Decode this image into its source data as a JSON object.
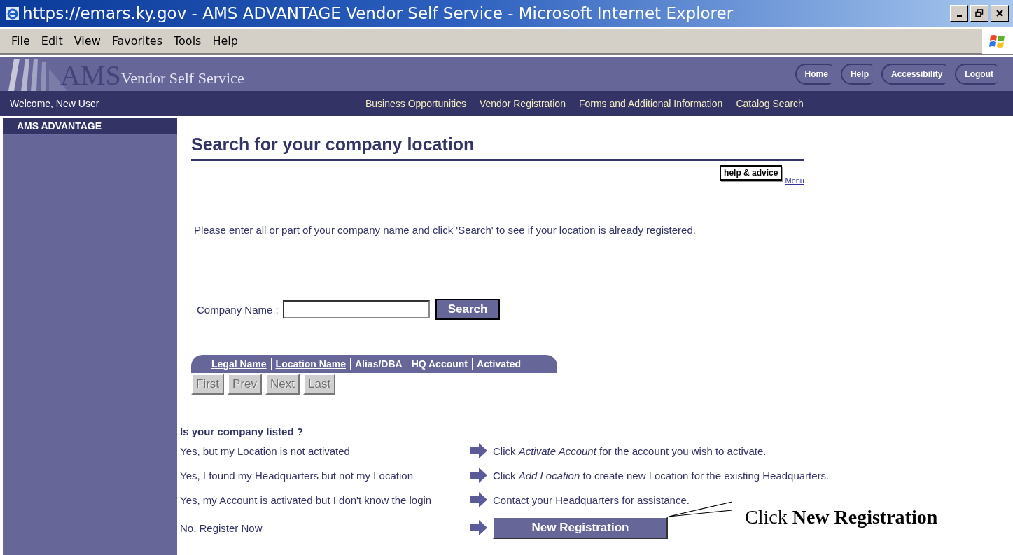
{
  "window": {
    "title": "https://emars.ky.gov - AMS ADVANTAGE Vendor Self Service - Microsoft Internet Explorer"
  },
  "menu_bar": [
    "File",
    "Edit",
    "View",
    "Favorites",
    "Tools",
    "Help"
  ],
  "banner": {
    "logo_mark": "AMS",
    "logo_text": "Vendor Self Service",
    "links": [
      "Home",
      "Help",
      "Accessibility",
      "Logout"
    ]
  },
  "nav_bar": {
    "welcome": "Welcome, New User",
    "links": [
      "Business Opportunities",
      "Vendor Registration",
      "Forms and Additional Information",
      "Catalog Search"
    ]
  },
  "sidebar": {
    "title": "AMS ADVANTAGE"
  },
  "page": {
    "heading": "Search for your company location",
    "help_button": "help & advice",
    "menu_link": "Menu",
    "instructions": "Please enter all or part of your company name and click 'Search' to see if your location is already registered.",
    "search": {
      "label": "Company Name :",
      "button": "Search"
    },
    "table": {
      "columns": [
        {
          "label": "Legal Name",
          "sortable": true
        },
        {
          "label": "Location Name",
          "sortable": true
        },
        {
          "label": "Alias/DBA",
          "sortable": false
        },
        {
          "label": "HQ Account",
          "sortable": false
        },
        {
          "label": "Activated",
          "sortable": false
        }
      ]
    },
    "pager": [
      {
        "label": "First",
        "disabled": true
      },
      {
        "label": "Prev",
        "disabled": true
      },
      {
        "label": "Next",
        "disabled": true
      },
      {
        "label": "Last",
        "disabled": true
      }
    ],
    "listed_question": "Is your company listed ?",
    "options": [
      {
        "question": "Yes, but my Location is not activated",
        "kind": "text",
        "action": "Click *Activate Account* for the account you wish to activate."
      },
      {
        "question": "Yes, I found my Headquarters but not my Location",
        "kind": "text",
        "action": "Click *Add Location* to create new Location for the existing Headquarters."
      },
      {
        "question": "Yes, my Account is activated but I don't know the login",
        "kind": "text",
        "action": "Contact your Headquarters for assistance."
      },
      {
        "question": "No, Register Now",
        "kind": "button",
        "action": "New Registration"
      }
    ]
  },
  "callout": {
    "text": "Click **New Registration**"
  }
}
